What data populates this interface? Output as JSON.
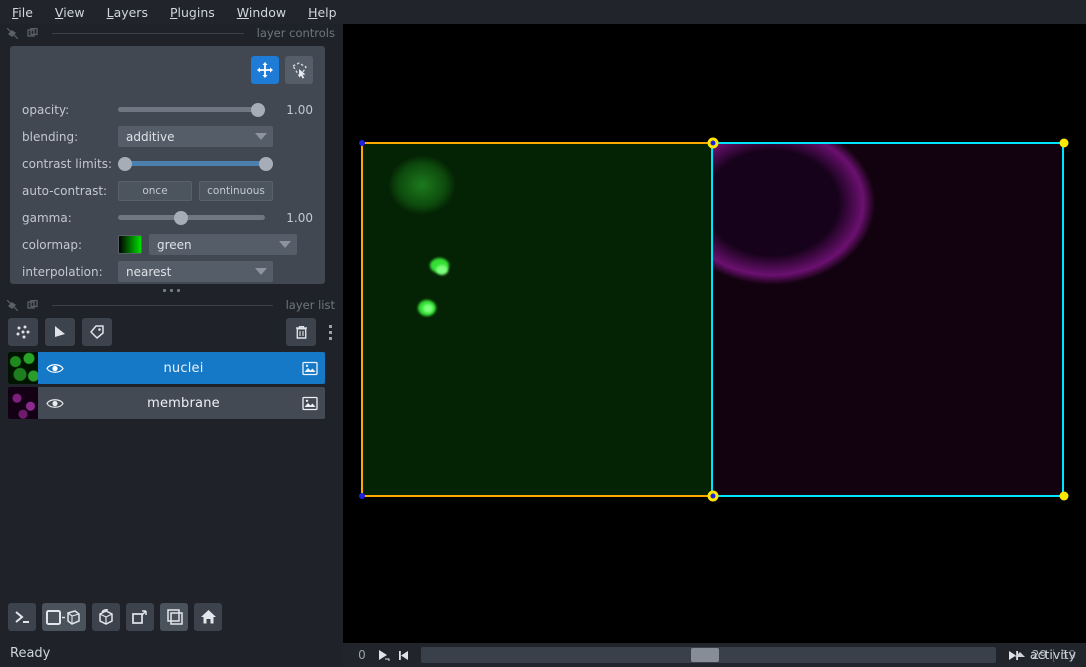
{
  "menubar": {
    "items": [
      {
        "acc": "F",
        "rest": "ile"
      },
      {
        "acc": "V",
        "rest": "iew"
      },
      {
        "acc": "L",
        "rest": "ayers"
      },
      {
        "acc": "P",
        "rest": "lugins"
      },
      {
        "acc": "W",
        "rest": "indow"
      },
      {
        "acc": "H",
        "rest": "elp"
      }
    ]
  },
  "layer_controls": {
    "dock_label": "layer controls",
    "tools": [
      {
        "name": "pan-zoom-tool",
        "active": true
      },
      {
        "name": "transform-tool",
        "active": false
      }
    ],
    "opacity": {
      "label": "opacity:",
      "value": "1.00",
      "percent": 100
    },
    "blending": {
      "label": "blending:",
      "value": "additive"
    },
    "contrast_limits": {
      "label": "contrast limits:",
      "low_percent": 0,
      "high_percent": 100
    },
    "auto_contrast": {
      "label": "auto-contrast:",
      "once": "once",
      "continuous": "continuous"
    },
    "gamma": {
      "label": "gamma:",
      "value": "1.00",
      "percent": 40
    },
    "colormap": {
      "label": "colormap:",
      "value": "green",
      "swatch_from": "#000000",
      "swatch_to": "#00e000"
    },
    "interpolation": {
      "label": "interpolation:",
      "value": "nearest"
    }
  },
  "layer_list": {
    "dock_label": "layer list",
    "toolbar": [
      {
        "name": "new-points-layer-button"
      },
      {
        "name": "new-shapes-layer-button"
      },
      {
        "name": "new-labels-layer-button"
      }
    ],
    "delete_label": "delete-layer-button",
    "layers": [
      {
        "name": "nuclei",
        "selected": true,
        "visible": true,
        "thumb": "green",
        "type": "image"
      },
      {
        "name": "membrane",
        "selected": false,
        "visible": true,
        "thumb": "magenta",
        "type": "image"
      }
    ]
  },
  "viewer_buttons": [
    {
      "name": "console-button"
    },
    {
      "name": "ndisplay-toggle-button"
    },
    {
      "name": "roll-dims-button"
    },
    {
      "name": "transpose-dims-button"
    },
    {
      "name": "grid-view-button"
    },
    {
      "name": "home-button"
    }
  ],
  "status": {
    "text": "Ready"
  },
  "dims": {
    "axis_label": "0",
    "play_label": "play-button",
    "current": "29",
    "max": "59",
    "slider_percent": 47
  },
  "activity": {
    "label": "activity"
  },
  "canvas": {
    "selection_boxes": [
      {
        "name": "nuclei-bounding-box",
        "color": "#ffa800"
      },
      {
        "name": "membrane-bounding-box",
        "color": "#00e5ff"
      }
    ]
  }
}
